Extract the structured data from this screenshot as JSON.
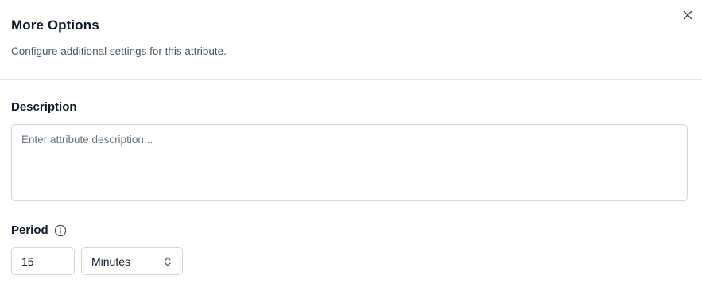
{
  "header": {
    "title": "More Options",
    "subtitle": "Configure additional settings for this attribute."
  },
  "description": {
    "label": "Description",
    "placeholder": "Enter attribute description...",
    "value": ""
  },
  "period": {
    "label": "Period",
    "info_icon": "info-circle-icon",
    "amount": "15",
    "unit": "Minutes",
    "unit_icon": "chevron-up-down-icon"
  },
  "icons": {
    "close": "close-icon"
  },
  "colors": {
    "border": "#d1d5db",
    "divider": "#e5e7eb",
    "text": "#111827",
    "muted": "#4b5563"
  }
}
